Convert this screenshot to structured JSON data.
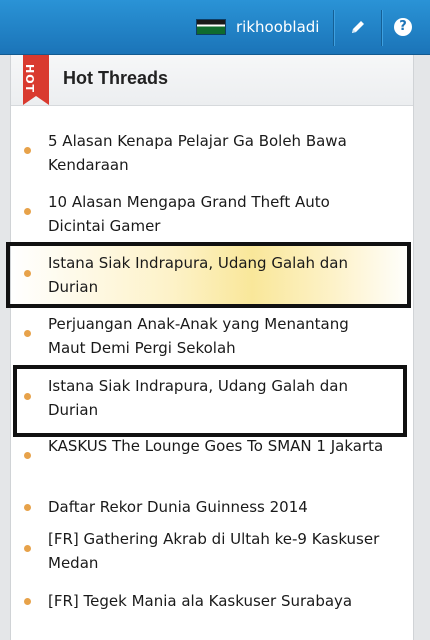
{
  "topbar": {
    "username": "rikhoobladi",
    "edit_icon": "pencil-icon",
    "help_icon": "question-circle-icon",
    "help_glyph": "?"
  },
  "panel": {
    "badge": "HOT",
    "title": "Hot Threads"
  },
  "threads": [
    {
      "title": "5 Alasan Kenapa Pelajar Ga Boleh Bawa Kendaraan"
    },
    {
      "title": "10 Alasan Mengapa Grand Theft Auto Dicintai Gamer"
    },
    {
      "title": "Istana Siak Indrapura, Udang Galah dan Durian",
      "highlighted": true
    },
    {
      "title": "Perjuangan Anak-Anak yang Menantang Maut Demi Pergi Sekolah"
    },
    {
      "title": "Istana Siak Indrapura, Udang Galah dan Durian"
    },
    {
      "title": "KASKUS The Lounge Goes To SMAN 1 Jakarta"
    },
    {
      "title": "Daftar Rekor Dunia Guinness 2014"
    },
    {
      "title": "[FR] Gathering Akrab di Ultah ke-9 Kaskuser Medan"
    },
    {
      "title": "[FR] Tegek Mania ala Kaskuser Surabaya"
    }
  ],
  "colors": {
    "topbar": "#1b74b8",
    "bullet": "#e7a24a",
    "ribbon": "#d93a2f",
    "highlight": "#f9e79a"
  }
}
